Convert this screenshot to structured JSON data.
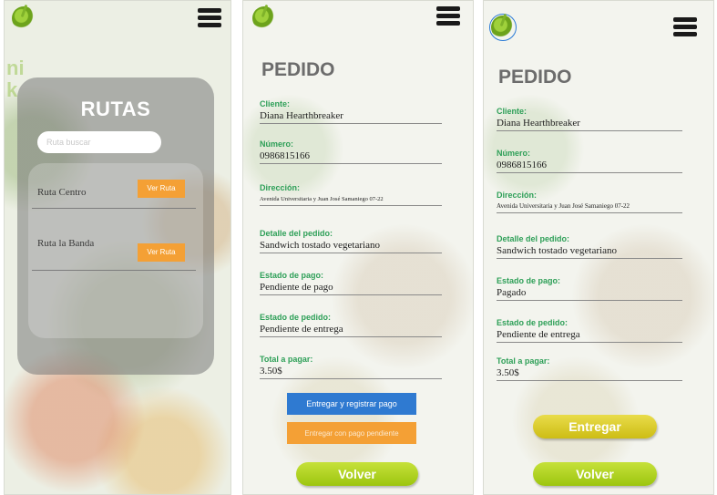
{
  "screen_rutas": {
    "logo_icon": "logo-leaf-icon",
    "menu_icon": "hamburger-menu-icon",
    "background_text": "ni\nk",
    "title": "RUTAS",
    "search": {
      "placeholder": "Ruta buscar",
      "value": ""
    },
    "routes": [
      {
        "name": "Ruta Centro",
        "button": "Ver Ruta"
      },
      {
        "name": "Ruta la Banda",
        "button": "Ver Ruta"
      }
    ]
  },
  "screen_pedido_pending": {
    "title": "PEDIDO",
    "fields": [
      {
        "label": "Cliente:",
        "value": "Diana Hearthbreaker"
      },
      {
        "label": "Número:",
        "value": "0986815166"
      },
      {
        "label": "Dirección:",
        "value": "Avenida Universitaria y Juan José Samaniego 07-22"
      },
      {
        "label": "Detalle del pedido:",
        "value": "Sandwich tostado vegetariano"
      },
      {
        "label": "Estado de pago:",
        "value": "Pendiente de pago"
      },
      {
        "label": "Estado de pedido:",
        "value": "Pendiente de entrega"
      },
      {
        "label": "Total a pagar:",
        "value": "3.50$"
      }
    ],
    "buttons": {
      "register": "Entregar y registrar pago",
      "pending": "Entregar con pago pendiente",
      "back": "Volver"
    }
  },
  "screen_pedido_paid": {
    "title": "PEDIDO",
    "fields": [
      {
        "label": "Cliente:",
        "value": "Diana Hearthbreaker"
      },
      {
        "label": "Número:",
        "value": "0986815166"
      },
      {
        "label": "Dirección:",
        "value": "Avenida Universitaria y Juan José Samaniego 07-22"
      },
      {
        "label": "Detalle del pedido:",
        "value": "Sandwich tostado vegetariano"
      },
      {
        "label": "Estado de pago:",
        "value": "Pagado"
      },
      {
        "label": "Estado de pedido:",
        "value": "Pendiente de entrega"
      },
      {
        "label": "Total a pagar:",
        "value": "3.50$"
      }
    ],
    "buttons": {
      "deliver": "Entregar",
      "back": "Volver"
    }
  },
  "colors": {
    "label_green": "#2d9f57",
    "button_blue": "#2f7ad1",
    "button_orange": "#f4a035",
    "button_lime": "#9cc50f",
    "button_yellow": "#cdbd15",
    "card_gray": "#787878"
  }
}
